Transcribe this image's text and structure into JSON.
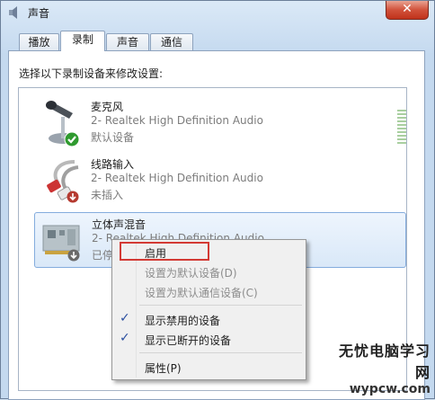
{
  "window": {
    "title": "声音",
    "close_glyph": "✕"
  },
  "tabs": [
    {
      "label": "播放",
      "active": false
    },
    {
      "label": "录制",
      "active": true
    },
    {
      "label": "声音",
      "active": false
    },
    {
      "label": "通信",
      "active": false
    }
  ],
  "instruction": "选择以下录制设备来修改设置:",
  "devices": [
    {
      "name": "麦克风",
      "description": "2- Realtek High Definition Audio",
      "status": "默认设备",
      "icon": "microphone-icon",
      "badge": "default-check",
      "selected": false
    },
    {
      "name": "线路输入",
      "description": "2- Realtek High Definition Audio",
      "status": "未插入",
      "icon": "line-in-jack-icon",
      "badge": "unplugged-arrow",
      "selected": false
    },
    {
      "name": "立体声混音",
      "description": "2- Realtek High Definition Audio",
      "status": "已停用",
      "icon": "sound-card-icon",
      "badge": "disabled-arrow",
      "selected": true
    }
  ],
  "context_menu": {
    "items": [
      {
        "label": "启用",
        "enabled": true,
        "checked": false
      },
      {
        "label": "设置为默认设备(D)",
        "enabled": false,
        "checked": false
      },
      {
        "label": "设置为默认通信设备(C)",
        "enabled": false,
        "checked": false
      },
      {
        "label": "显示禁用的设备",
        "enabled": true,
        "checked": true
      },
      {
        "label": "显示已断开的设备",
        "enabled": true,
        "checked": true
      },
      {
        "label": "属性(P)",
        "enabled": true,
        "checked": false
      }
    ]
  },
  "watermark": {
    "line1": "无忧电脑学习网",
    "line2": "wypcw.com"
  },
  "colors": {
    "highlight_box": "#d33a34",
    "selection": "#d9e8f8",
    "check": "#2b4fa0"
  }
}
